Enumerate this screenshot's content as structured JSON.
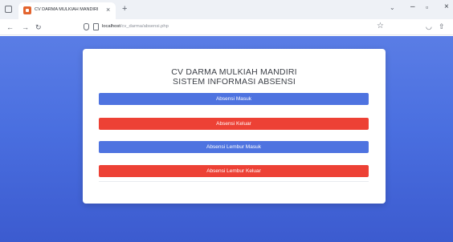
{
  "browser": {
    "tab_title": "CV DARMA MULKIAH MANDIRI",
    "tab_close": "×",
    "new_tab": "+",
    "url_host": "localhost",
    "url_path": "/cv_darma/absensi.php",
    "window_min": "–",
    "window_max": "▫",
    "window_close": "×"
  },
  "page": {
    "title_line1": "CV DARMA MULKIAH MANDIRI",
    "title_line2": "SISTEM INFORMASI ABSENSI",
    "buttons": [
      {
        "label": "Absensi Masuk",
        "color": "#4e73e0"
      },
      {
        "label": "Absensi Keluar",
        "color": "#ed4135"
      },
      {
        "label": "Absensi Lembur Masuk",
        "color": "#4e73e0"
      },
      {
        "label": "Absensi Lembur Keluar",
        "color": "#ed4135"
      }
    ]
  },
  "icons": {
    "tab_favicon": "favicon-icon",
    "back": "back-arrow-icon",
    "forward": "forward-arrow-icon",
    "reload": "reload-icon",
    "shield": "shield-icon",
    "page": "page-icon",
    "star": "star-icon",
    "pocket": "pocket-icon",
    "share": "share-icon",
    "more": "more-icon"
  }
}
